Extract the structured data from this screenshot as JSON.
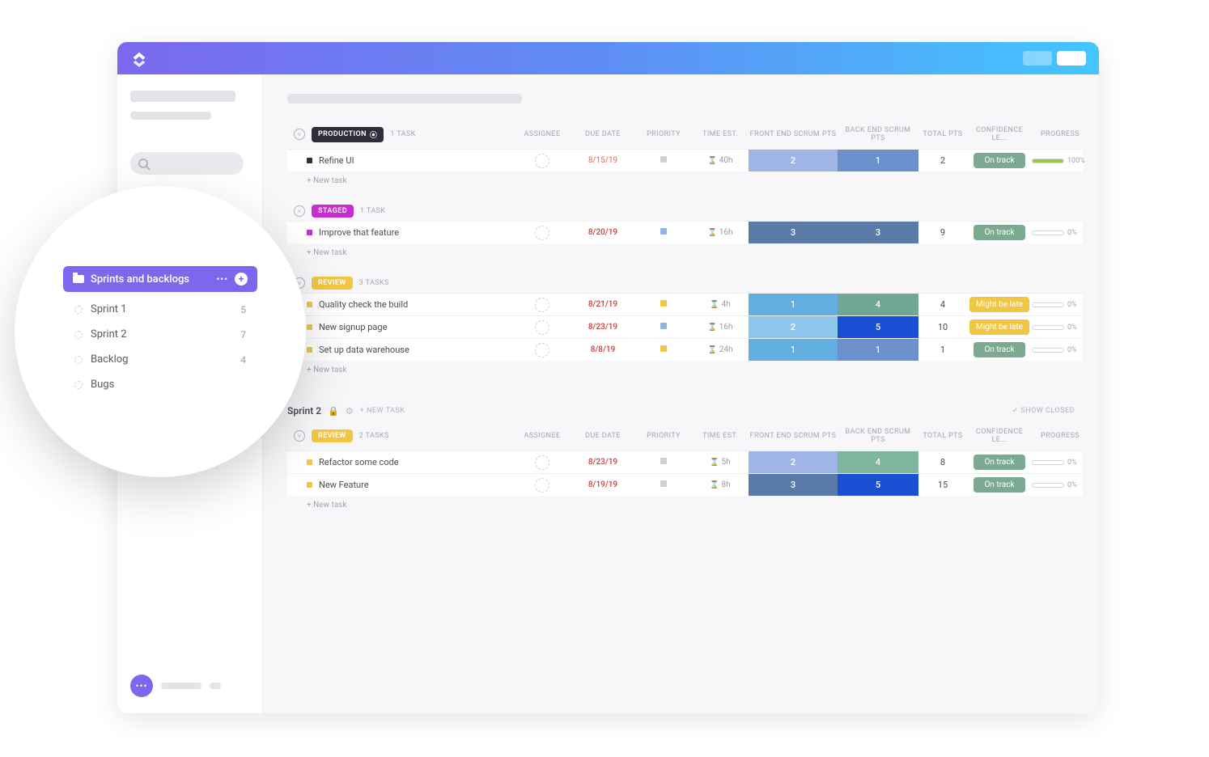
{
  "columns": {
    "assignee": "ASSIGNEE",
    "due": "DUE DATE",
    "priority": "PRIORITY",
    "time": "TIME EST.",
    "front": "FRONT END SCRUM PTS",
    "back": "BACK END SCRUM PTS",
    "total": "TOTAL PTS",
    "conf": "CONFIDENCE LE...",
    "progress": "PROGRESS"
  },
  "groups": {
    "production": {
      "label": "PRODUCTION",
      "task_count": "1 TASK"
    },
    "staged": {
      "label": "STAGED",
      "task_count": "1 TASK"
    },
    "review": {
      "label": "REVIEW",
      "task_count": "3 TASKS"
    },
    "review2": {
      "label": "REVIEW",
      "task_count": "2 TASKS"
    }
  },
  "tasks": {
    "t1": {
      "name": "Refine UI",
      "due": "8/15/19",
      "time": "40h",
      "front": "2",
      "back": "1",
      "total": "2",
      "conf": "On track",
      "progress": "100%"
    },
    "t2": {
      "name": "Improve that feature",
      "due": "8/20/19",
      "time": "16h",
      "front": "3",
      "back": "3",
      "total": "9",
      "conf": "On track",
      "progress": "0%"
    },
    "t3": {
      "name": "Quality check the build",
      "due": "8/21/19",
      "time": "4h",
      "front": "1",
      "back": "4",
      "total": "4",
      "conf": "Might be late",
      "progress": "0%"
    },
    "t4": {
      "name": "New signup page",
      "due": "8/23/19",
      "time": "16h",
      "front": "2",
      "back": "5",
      "total": "10",
      "conf": "Might be late",
      "progress": "0%"
    },
    "t5": {
      "name": "Set up data warehouse",
      "due": "8/8/19",
      "time": "24h",
      "front": "1",
      "back": "1",
      "total": "1",
      "conf": "On track",
      "progress": "0%"
    },
    "t6": {
      "name": "Refactor some code",
      "due": "8/23/19",
      "time": "5h",
      "front": "2",
      "back": "4",
      "total": "8",
      "conf": "On track",
      "progress": "0%"
    },
    "t7": {
      "name": "New Feature",
      "due": "8/19/19",
      "time": "8h",
      "front": "3",
      "back": "5",
      "total": "15",
      "conf": "On track",
      "progress": "0%"
    }
  },
  "labels": {
    "new_task": "+ New task",
    "sprint2": "Sprint 2",
    "new_task_caps": "+ NEW TASK",
    "show_closed": "SHOW CLOSED"
  },
  "popout": {
    "folder": "Sprints and backlogs",
    "items": [
      {
        "label": "Sprint 1",
        "count": "5"
      },
      {
        "label": "Sprint 2",
        "count": "7"
      },
      {
        "label": "Backlog",
        "count": "4"
      },
      {
        "label": "Bugs",
        "count": ""
      }
    ]
  }
}
